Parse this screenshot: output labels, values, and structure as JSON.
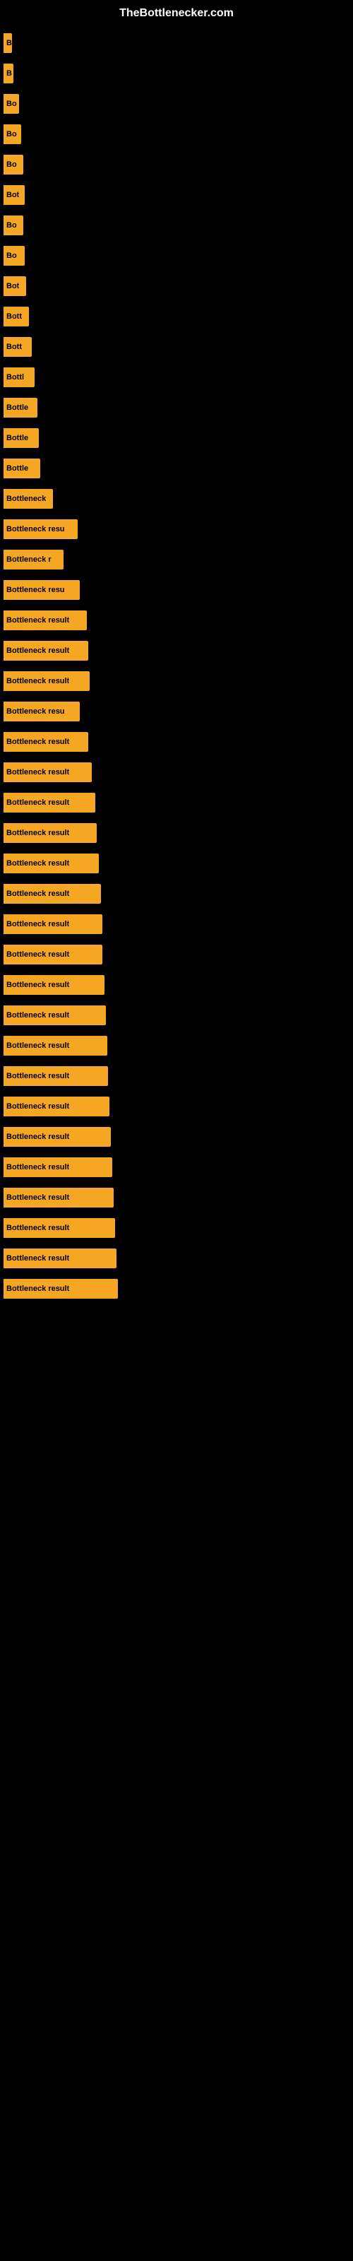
{
  "site": {
    "title": "TheBottlenecker.com"
  },
  "bars": [
    {
      "label": "B",
      "width": 12
    },
    {
      "label": "B",
      "width": 14
    },
    {
      "label": "Bo",
      "width": 22
    },
    {
      "label": "Bo",
      "width": 25
    },
    {
      "label": "Bo",
      "width": 28
    },
    {
      "label": "Bot",
      "width": 30
    },
    {
      "label": "Bo",
      "width": 28
    },
    {
      "label": "Bo",
      "width": 30
    },
    {
      "label": "Bot",
      "width": 32
    },
    {
      "label": "Bott",
      "width": 36
    },
    {
      "label": "Bott",
      "width": 40
    },
    {
      "label": "Bottl",
      "width": 44
    },
    {
      "label": "Bottle",
      "width": 48
    },
    {
      "label": "Bottle",
      "width": 50
    },
    {
      "label": "Bottle",
      "width": 52
    },
    {
      "label": "Bottleneck",
      "width": 70
    },
    {
      "label": "Bottleneck resu",
      "width": 105
    },
    {
      "label": "Bottleneck r",
      "width": 85
    },
    {
      "label": "Bottleneck resu",
      "width": 108
    },
    {
      "label": "Bottleneck result",
      "width": 118
    },
    {
      "label": "Bottleneck result",
      "width": 120
    },
    {
      "label": "Bottleneck result",
      "width": 122
    },
    {
      "label": "Bottleneck resu",
      "width": 108
    },
    {
      "label": "Bottleneck result",
      "width": 120
    },
    {
      "label": "Bottleneck result",
      "width": 125
    },
    {
      "label": "Bottleneck result",
      "width": 130
    },
    {
      "label": "Bottleneck result",
      "width": 132
    },
    {
      "label": "Bottleneck result",
      "width": 135
    },
    {
      "label": "Bottleneck result",
      "width": 138
    },
    {
      "label": "Bottleneck result",
      "width": 140
    },
    {
      "label": "Bottleneck result",
      "width": 140
    },
    {
      "label": "Bottleneck result",
      "width": 143
    },
    {
      "label": "Bottleneck result",
      "width": 145
    },
    {
      "label": "Bottleneck result",
      "width": 147
    },
    {
      "label": "Bottleneck result",
      "width": 148
    },
    {
      "label": "Bottleneck result",
      "width": 150
    },
    {
      "label": "Bottleneck result",
      "width": 152
    },
    {
      "label": "Bottleneck result",
      "width": 154
    },
    {
      "label": "Bottleneck result",
      "width": 156
    },
    {
      "label": "Bottleneck result",
      "width": 158
    },
    {
      "label": "Bottleneck result",
      "width": 160
    },
    {
      "label": "Bottleneck result",
      "width": 162
    }
  ]
}
